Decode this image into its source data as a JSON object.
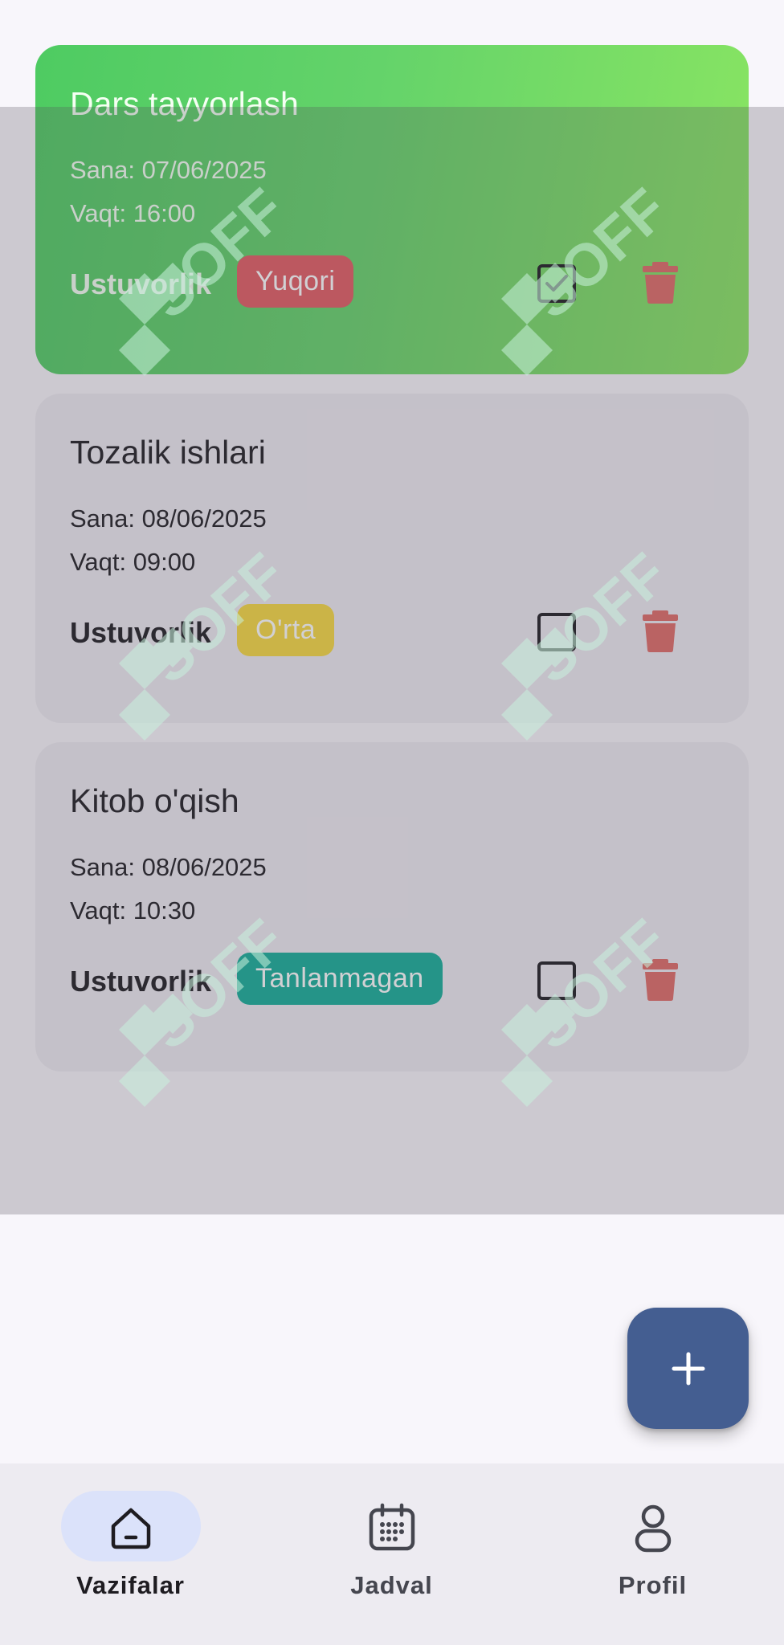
{
  "tasks": [
    {
      "title": "Dars tayyorlash",
      "date": "Sana: 07/06/2025",
      "time": "Vaqt: 16:00",
      "priority_label": "Ustuvorlik",
      "priority": "Yuqori",
      "priority_color": "#c64b52",
      "completed": true
    },
    {
      "title": "Tozalik ishlari",
      "date": "Sana: 08/06/2025",
      "time": "Vaqt: 09:00",
      "priority_label": "Ustuvorlik",
      "priority": "O'rta",
      "priority_color": "#d7b833",
      "completed": false
    },
    {
      "title": "Kitob o'qish",
      "date": "Sana: 08/06/2025",
      "time": "Vaqt: 10:30",
      "priority_label": "Ustuvorlik",
      "priority": "Tanlanmagan",
      "priority_color": "#0f9684",
      "completed": false
    }
  ],
  "watermark_text": "SOFF",
  "fab": {
    "icon": "plus-icon",
    "color": "#445e91"
  },
  "bottom_nav": {
    "active": "tasks",
    "items": [
      {
        "label": "Vazifalar",
        "icon": "home-icon"
      },
      {
        "label": "Jadval",
        "icon": "calendar-icon"
      },
      {
        "label": "Profil",
        "icon": "person-icon"
      }
    ]
  },
  "colors": {
    "trash": "#c85a58",
    "card_done_gradient": [
      "#4ecb62",
      "#8ae562"
    ],
    "card_default": "#eeebf2",
    "nav_indicator": "#dbe2fa"
  }
}
